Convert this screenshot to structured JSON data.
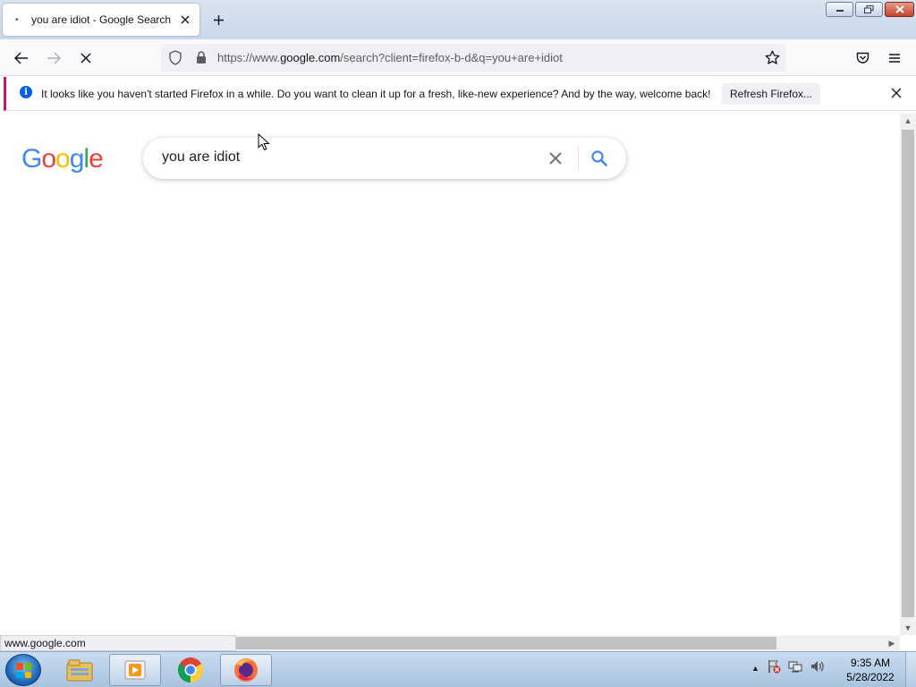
{
  "browser": {
    "tab": {
      "title": "you are idiot - Google Search"
    },
    "url": {
      "prefix": "https://www.",
      "domain": "google.com",
      "rest": "/search?client=firefox-b-d&q=you+are+idiot"
    }
  },
  "notification": {
    "message": "It looks like you haven't started Firefox in a while. Do you want to clean it up for a fresh, like-new experience? And by the way, welcome back!",
    "button_label": "Refresh Firefox..."
  },
  "page": {
    "logo_letters": [
      {
        "ch": "G",
        "color": "#4285F4"
      },
      {
        "ch": "o",
        "color": "#EA4335"
      },
      {
        "ch": "o",
        "color": "#FBBC05"
      },
      {
        "ch": "g",
        "color": "#4285F4"
      },
      {
        "ch": "l",
        "color": "#34A853"
      },
      {
        "ch": "e",
        "color": "#EA4335"
      }
    ],
    "search_query": "you are idiot"
  },
  "status_bar": {
    "text": "www.google.com"
  },
  "taskbar": {
    "apps": [
      "windows-explorer",
      "media-player",
      "chrome",
      "firefox"
    ],
    "clock": {
      "time": "9:35 AM",
      "date": "5/28/2022"
    }
  },
  "colors": {
    "accent": "#0060df",
    "notification_bar": "#c2186f",
    "search_icon": "#4285F4"
  }
}
